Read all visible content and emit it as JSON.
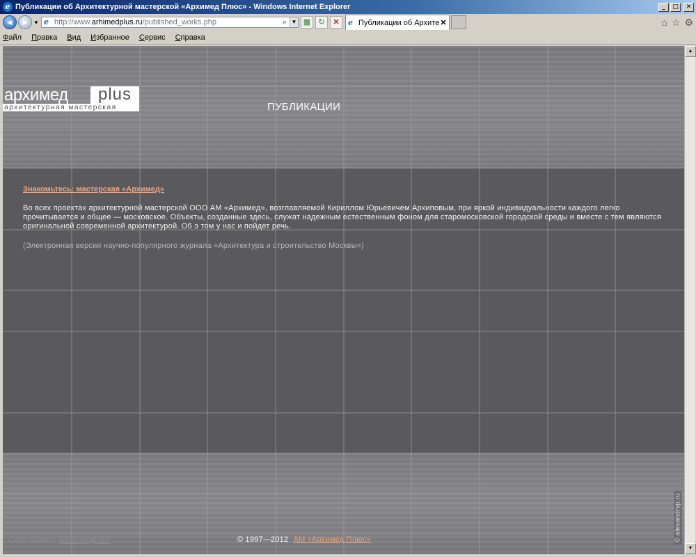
{
  "window": {
    "title": "Публикации об Архитектурной мастерской «Архимед Плюс» - Windows Internet Explorer",
    "minimize": "_",
    "maximize": "□",
    "close": "✕"
  },
  "navbar": {
    "url_prefix": "http://www.",
    "url_domain": "arhimedplus.ru",
    "url_path": "/published_works.php",
    "tab_label": "Публикации об Архитектурной мастерской «Архимед Плюс»"
  },
  "menu": [
    "Файл",
    "Правка",
    "Вид",
    "Избранное",
    "Сервис",
    "Справка"
  ],
  "logo": {
    "main": "архимед",
    "plus": "plus",
    "sub": "архитектурная мастерская"
  },
  "page": {
    "title": "ПУБЛИКАЦИИ"
  },
  "article": {
    "link": "Знакомьтесь: мастерская «Архимед»",
    "body": "Во всех проектах архитектурной мастерской ООО АМ «Архимед», возглавляемой Кириллом Юрьевичем Архиповым, при яркой индивидуальности каждого легко прочитывается и общее — московское. Объекты, созданные здесь, служат надежным естественным фоном для старомосковской городской среды и вместе с тем являются оригинальной современной архитектурой. Об э том у нас и пойдет речь.",
    "source": "(Электронная версия научно-популярного журнала «Архитектура и строительство Москвы»)"
  },
  "footer": {
    "copyright": "© 1997—2012",
    "company_link": "АМ «Архимед Плюс»",
    "made_by_label": "Сайт оживил:",
    "made_by_link": "Александр ВП",
    "watermark": "© alexandrvp.ru"
  }
}
